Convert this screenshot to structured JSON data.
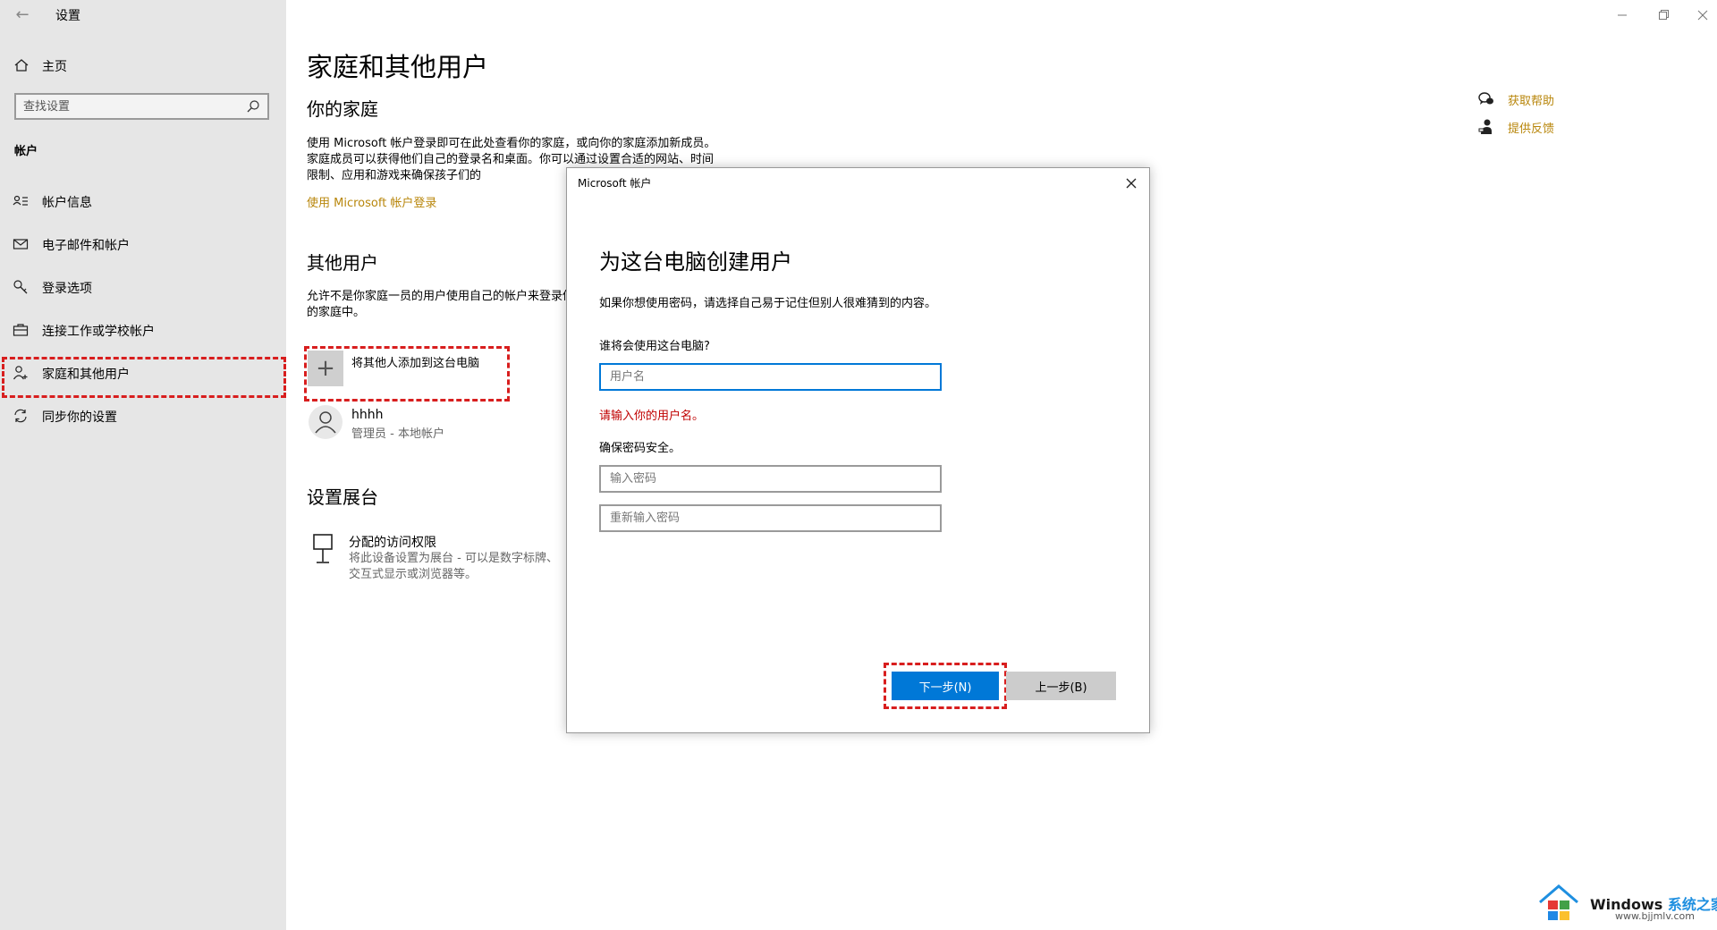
{
  "window": {
    "title": "设置",
    "controls": [
      "minimize-icon",
      "restore-icon",
      "close-icon"
    ]
  },
  "sidebar": {
    "home_label": "主页",
    "search_placeholder": "查找设置",
    "section_label": "帐户",
    "items": [
      {
        "label": "帐户信息",
        "icon": "account-info-icon"
      },
      {
        "label": "电子邮件和帐户",
        "icon": "mail-icon"
      },
      {
        "label": "登录选项",
        "icon": "key-icon"
      },
      {
        "label": "连接工作或学校帐户",
        "icon": "briefcase-icon"
      },
      {
        "label": "家庭和其他用户",
        "icon": "person-add-icon",
        "selected": true,
        "highlighted": true
      },
      {
        "label": "同步你的设置",
        "icon": "sync-icon"
      }
    ]
  },
  "main": {
    "title": "家庭和其他用户",
    "family": {
      "heading": "你的家庭",
      "description": "使用 Microsoft 帐户登录即可在此处查看你的家庭，或向你的家庭添加新成员。家庭成员可以获得他们自己的登录名和桌面。你可以通过设置合适的网站、时间限制、应用和游戏来确保孩子们的",
      "link": "使用 Microsoft 帐户登录"
    },
    "other_users": {
      "heading": "其他用户",
      "description": "允许不是你家庭一员的用户使用自己的帐户来登录你的家庭中。",
      "add_label": "将其他人添加到这台电脑",
      "user_name": "hhhh",
      "user_role": "管理员 - 本地帐户"
    },
    "kiosk": {
      "heading": "设置展台",
      "title": "分配的访问权限",
      "description": "将此设备设置为展台 - 可以是数字标牌、交互式显示或浏览器等。"
    },
    "help_link": "获取帮助",
    "feedback_link": "提供反馈"
  },
  "dialog": {
    "title": "Microsoft 帐户",
    "heading": "为这台电脑创建用户",
    "intro": "如果你想使用密码，请选择自己易于记住但别人很难猜到的内容。",
    "who_label": "谁将会使用这台电脑?",
    "username_placeholder": "用户名",
    "username_value": "",
    "error_text": "请输入你的用户名。",
    "secure_label": "确保密码安全。",
    "password_placeholder": "输入密码",
    "password_confirm_placeholder": "重新输入密码",
    "next_label": "下一步(N)",
    "back_label": "上一步(B)"
  },
  "watermark": {
    "brand": "Windows",
    "brand_suffix": "系统之家",
    "url": "www.bjjmlv.com"
  },
  "colors": {
    "accent": "#0078d7",
    "link": "#b8860b",
    "error": "#c00000",
    "highlight": "#d81e1e",
    "sidebar_bg": "#e6e6e6"
  }
}
